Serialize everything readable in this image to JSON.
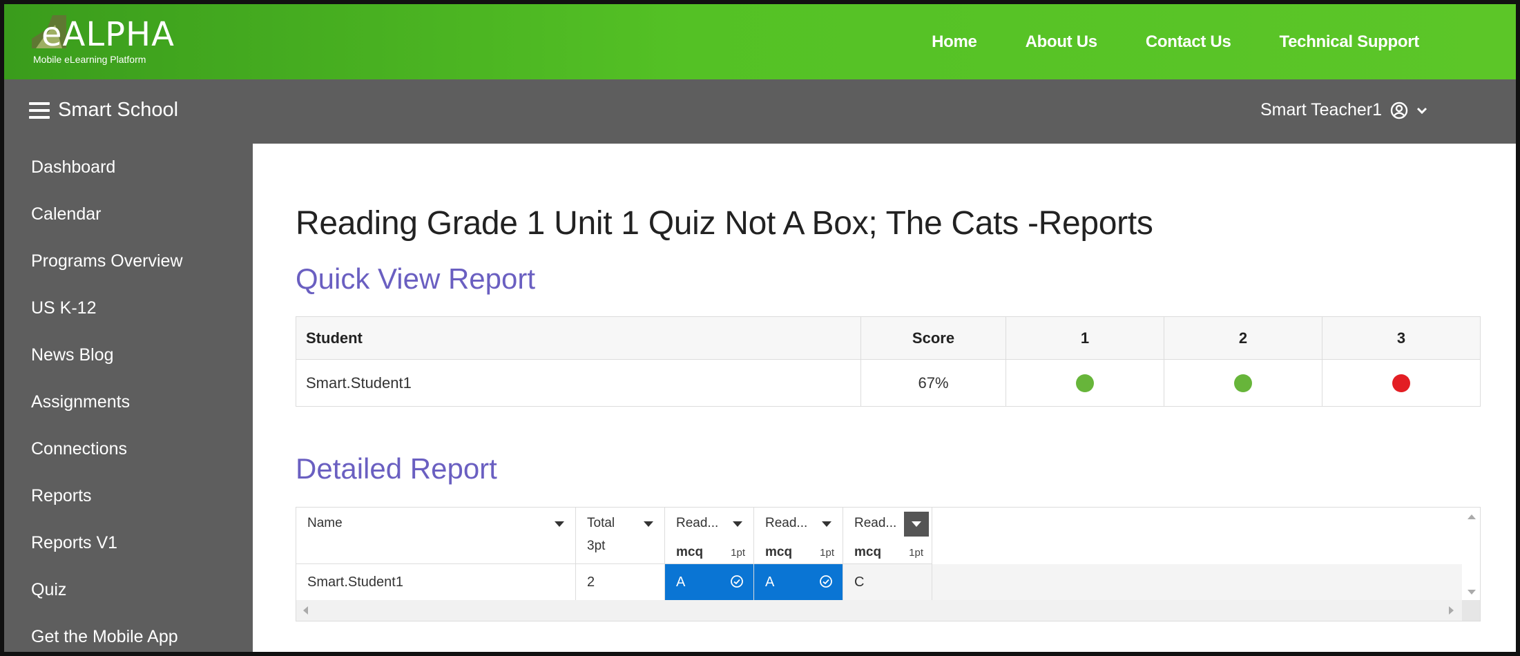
{
  "brand": {
    "logo_text": "eALPHA",
    "logo_sub": "Mobile eLearning Platform"
  },
  "topnav": {
    "items": [
      "Home",
      "About Us",
      "Contact Us",
      "Technical Support"
    ]
  },
  "appbar": {
    "title": "Smart School",
    "user_name": "Smart Teacher1",
    "user_icon": "user-circle-icon",
    "dropdown_icon": "chevron-down-icon"
  },
  "sidebar": {
    "items": [
      "Dashboard",
      "Calendar",
      "Programs Overview",
      "US K-12",
      "News Blog",
      "Assignments",
      "Connections",
      "Reports",
      "Reports V1",
      "Quiz",
      "Get the Mobile App"
    ]
  },
  "main": {
    "page_title": "Reading Grade 1 Unit 1 Quiz Not A Box; The Cats -Reports",
    "quick_view": {
      "title": "Quick View Report",
      "headers": [
        "Student",
        "Score",
        "1",
        "2",
        "3"
      ],
      "rows": [
        {
          "student": "Smart.Student1",
          "score": "67%",
          "results": [
            "correct",
            "correct",
            "incorrect"
          ]
        }
      ],
      "colors": {
        "correct": "#67b53a",
        "incorrect": "#e31e24"
      }
    },
    "detailed": {
      "title": "Detailed Report",
      "headers": {
        "name": "Name",
        "total": "Total",
        "total_points": "3pt",
        "q1": "Read...",
        "q2": "Read...",
        "q3": "Read...",
        "type": "mcq",
        "points": "1pt"
      },
      "rows": [
        {
          "name": "Smart.Student1",
          "total": "2",
          "answers": [
            "A",
            "A",
            "C"
          ]
        }
      ],
      "selected_color": "#0a75d4"
    }
  }
}
